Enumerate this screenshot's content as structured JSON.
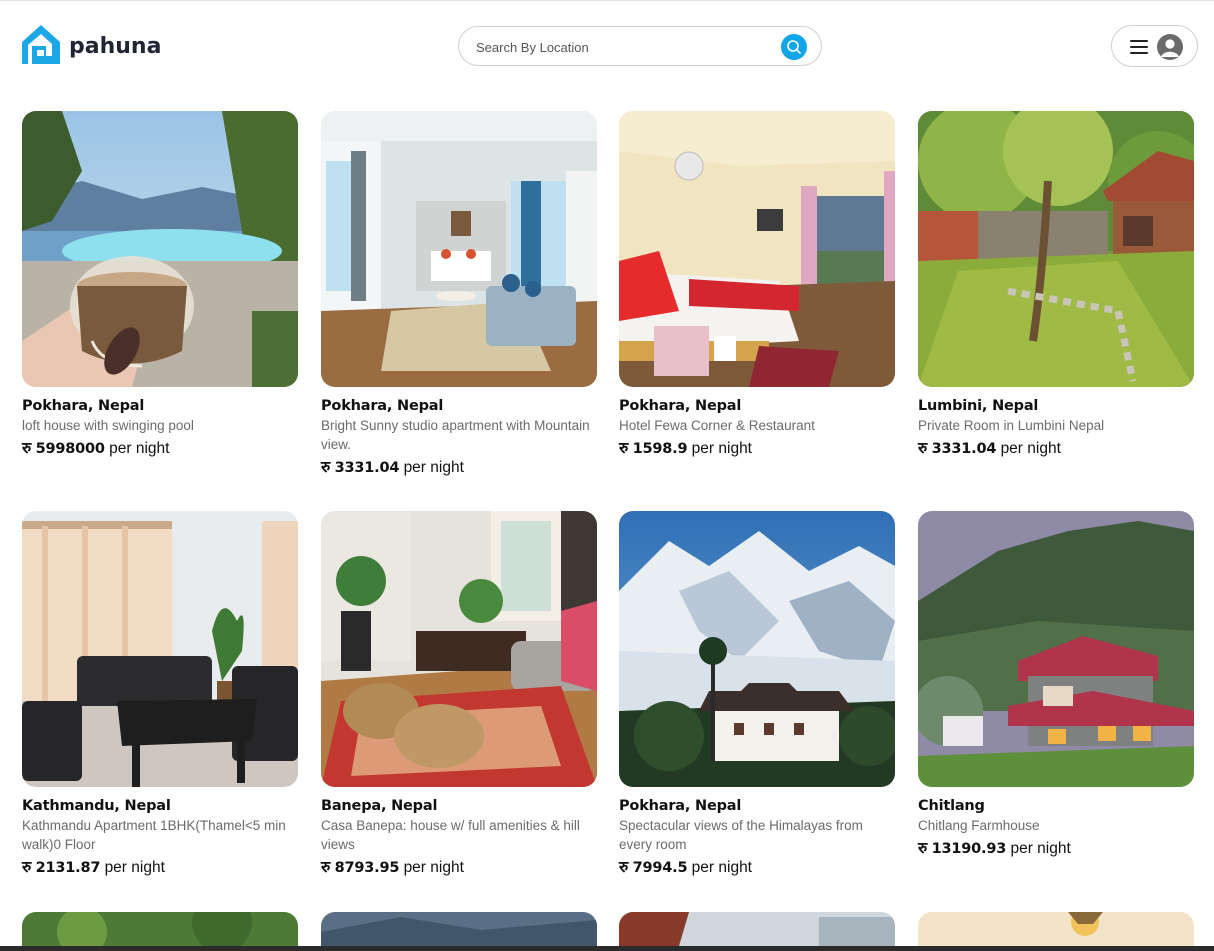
{
  "app": {
    "name": "pahuna"
  },
  "search": {
    "placeholder": "Search By Location"
  },
  "header": {
    "menu_icon": "hamburger-icon",
    "avatar_icon": "user-avatar-icon",
    "search_icon": "search-icon"
  },
  "listings": [
    {
      "location": "Pokhara, Nepal",
      "description": "loft house with swinging pool",
      "currency": "रु",
      "price": "5998000",
      "unit": "per night"
    },
    {
      "location": "Pokhara, Nepal",
      "description": "Bright Sunny studio apartment with Mountain view.",
      "currency": "रु",
      "price": "3331.04",
      "unit": "per night"
    },
    {
      "location": "Pokhara, Nepal",
      "description": "Hotel Fewa Corner & Restaurant",
      "currency": "रु",
      "price": "1598.9",
      "unit": "per night"
    },
    {
      "location": "Lumbini, Nepal",
      "description": "Private Room in Lumbini Nepal",
      "currency": "रु",
      "price": "3331.04",
      "unit": "per night"
    },
    {
      "location": "Kathmandu, Nepal",
      "description": "Kathmandu Apartment 1BHK(Thamel<5 min walk)0 Floor",
      "currency": "रु",
      "price": "2131.87",
      "unit": "per night"
    },
    {
      "location": "Banepa, Nepal",
      "description": "Casa Banepa: house w/ full amenities & hill views",
      "currency": "रु",
      "price": "8793.95",
      "unit": "per night"
    },
    {
      "location": "Pokhara, Nepal",
      "description": "Spectacular views of the Himalayas from every room",
      "currency": "रु",
      "price": "7994.5",
      "unit": "per night"
    },
    {
      "location": "Chitlang",
      "description": "Chitlang Farmhouse",
      "currency": "रु",
      "price": "13190.93",
      "unit": "per night"
    }
  ]
}
